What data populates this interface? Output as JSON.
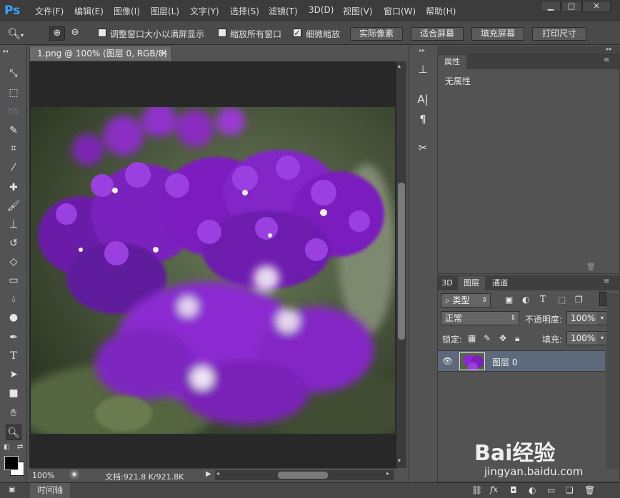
{
  "app": {
    "logo": "Ps",
    "menus": [
      "文件(F)",
      "编辑(E)",
      "图像(I)",
      "图层(L)",
      "文字(Y)",
      "选择(S)",
      "滤镜(T)",
      "3D(D)",
      "视图(V)",
      "窗口(W)",
      "帮助(H)"
    ],
    "accent": "#31a8ff"
  },
  "options": {
    "resize_windows_label": "调整窗口大小以满屏显示",
    "zoom_all_label": "缩放所有窗口",
    "scrubby_label": "细微缩放",
    "actual_pixels": "实际像素",
    "fit_screen": "适合屏幕",
    "fill_screen": "填充屏幕",
    "print_size": "打印尺寸"
  },
  "document": {
    "tab_title": "1.png @ 100% (图层 0, RGB/8)",
    "zoom": "100%",
    "doc_size": "文档:921.8 K/921.8K"
  },
  "timeline_label": "时间轴",
  "properties": {
    "tab": "属性",
    "content": "无属性"
  },
  "layers": {
    "tabs": [
      "3D",
      "图层",
      "通道"
    ],
    "filter_kind": "类型",
    "blend_mode": "正常",
    "opacity_label": "不透明度:",
    "opacity_value": "100%",
    "lock_label": "锁定:",
    "fill_label": "填充:",
    "fill_value": "100%",
    "layer_name": "图层 0"
  },
  "watermark": {
    "brand": "Bai经验",
    "url": "jingyan.baidu.com"
  }
}
